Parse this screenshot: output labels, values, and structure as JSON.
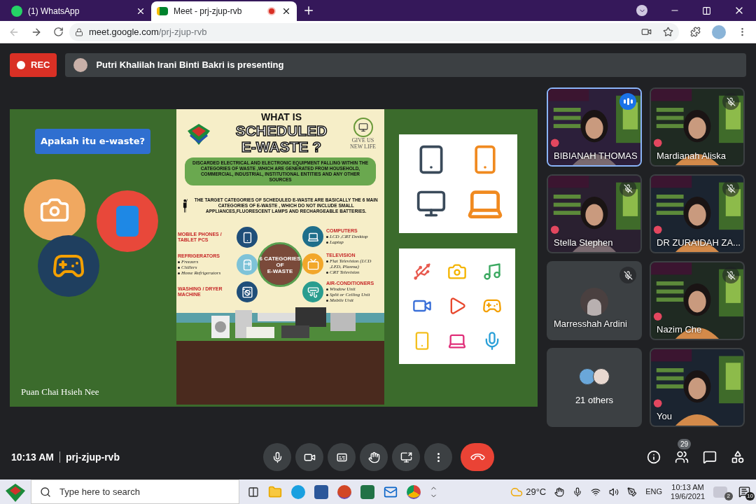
{
  "browser": {
    "tabs": [
      {
        "title": "(1) WhatsApp",
        "selected": false,
        "kind": "whatsapp"
      },
      {
        "title": "Meet - prj-zjup-rvb",
        "selected": true,
        "kind": "meet"
      }
    ],
    "url": {
      "domain": "meet.google.com",
      "path": "/prj-zjup-rvb"
    }
  },
  "meet": {
    "rec_label": "REC",
    "presenting_text": "Putri Khalilah Irani Binti Bakri is presenting"
  },
  "slide": {
    "callout": "Apakah itu e-waste?",
    "presenter_name": "Puan Chai Hsieh Nee",
    "poster": {
      "heading": "WHAT IS",
      "title_lines": [
        "SCHEDULED",
        "E-WASTE ?"
      ],
      "badge_lines": [
        "GIVE US",
        "NEW LIFE"
      ],
      "definition": "DISCARDED ELECTRICAL AND ELECTRONIC EQUIPMENT FALLING WITHIN THE CATEGORIES OF WASTE ,WHICH ARE GENERATED FROM HOUSEHOLD, COMMERCIAL, INDUSTRIAL, INSTITUTIONAL ENTITIES AND ANY OTHER SOURCES",
      "target_text": "THE TARGET CATEGORIES OF SCHEDULED E-WASTE ARE BASICALLY THE 6 MAIN CATEGORIES OF E-WASTE , WHICH DO NOT INCLUDE SMALL APPLIANCES,FLUORESCENT LAMPS AND RECHARGEABLE BATTERIES.",
      "center_lines": [
        "6 CATEGORIES",
        "OF",
        "E-WASTE"
      ],
      "left_categories": [
        {
          "name": "MOBILE PHONES / TABLET PCS",
          "kind": "phone"
        },
        {
          "name": "REFRIGERATORS",
          "kind": "fridge",
          "items": [
            "Freezers",
            "Chillers",
            "Home Refrigerators"
          ]
        },
        {
          "name": "WASHING / DRYER MACHINE",
          "kind": "washer"
        }
      ],
      "right_categories": [
        {
          "name": "COMPUTERS",
          "kind": "laptop",
          "items": [
            "LCD ,CRT Desktop",
            "Laptop"
          ]
        },
        {
          "name": "TELEVISION",
          "kind": "tv",
          "items": [
            "Flat Television (LCD ,LED, Plasma)",
            "CRT Television"
          ]
        },
        {
          "name": "AIR-CONDITIONERS",
          "kind": "aircon",
          "items": [
            "Window Unit",
            "Split or Ceiling Unit",
            "Mobile Unit"
          ]
        }
      ]
    }
  },
  "participants": [
    {
      "name": "BIBIANAH THOMAS",
      "kind": "video",
      "speaking": true,
      "muted": false
    },
    {
      "name": "Mardianah Aliska",
      "kind": "video",
      "speaking": false,
      "muted": true
    },
    {
      "name": "Stella Stephen",
      "kind": "video",
      "speaking": false,
      "muted": true
    },
    {
      "name": "DR ZURAIDAH ZA...",
      "kind": "video",
      "speaking": false,
      "muted": true
    },
    {
      "name": "Marresshah Ardini",
      "kind": "avatar",
      "speaking": false,
      "muted": true
    },
    {
      "name": "Nazim Che",
      "kind": "video",
      "speaking": false,
      "muted": true
    },
    {
      "name": "21 others",
      "kind": "others",
      "speaking": false,
      "muted": false
    },
    {
      "name": "You",
      "kind": "video",
      "speaking": false,
      "muted": false
    }
  ],
  "bottom_bar": {
    "time": "10:13 AM",
    "meeting_code": "prj-zjup-rvb",
    "participant_count": "29"
  },
  "taskbar": {
    "search_placeholder": "Type here to search",
    "temperature": "29°C",
    "language": "ENG",
    "time": "10:13 AM",
    "date": "19/6/2021",
    "app_badge": "2",
    "notifications": "10"
  }
}
